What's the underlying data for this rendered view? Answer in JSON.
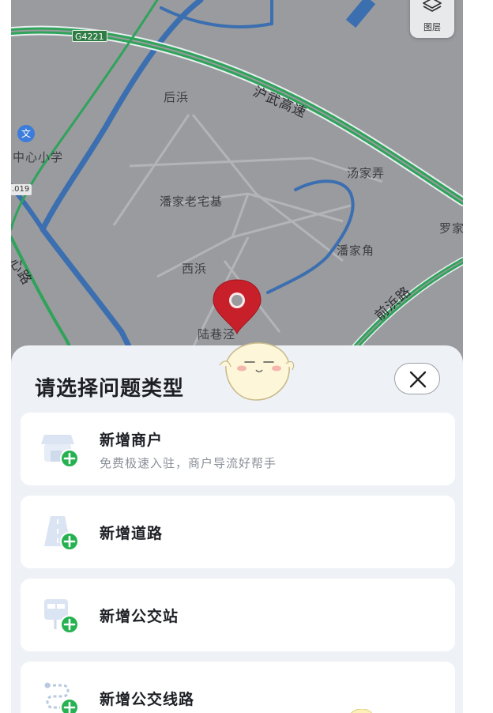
{
  "map": {
    "labels": {
      "houbang": "后浜",
      "huwu": "沪武高速",
      "school": "中心小学",
      "tangjianong": "汤家弄",
      "panjia_old": "潘家老宅基",
      "luojia": "罗家",
      "panjiajiao": "潘家角",
      "xibang": "西浜",
      "qianbang": "前浜路",
      "luxiangjing": "陆巷泾",
      "road_left": "心路"
    },
    "route_shield": "G4221",
    "route_shield2": ".019",
    "poi_badge": "文",
    "layers_label": "图层"
  },
  "sheet": {
    "title": "请选择问题类型",
    "close_icon": "close-icon",
    "options": [
      {
        "title": "新增商户",
        "subtitle": "免费极速入驻，商户导流好帮手",
        "icon": "storefront-add-icon"
      },
      {
        "title": "新增道路",
        "icon": "road-add-icon"
      },
      {
        "title": "新增公交站",
        "icon": "bus-stop-add-icon"
      },
      {
        "title": "新增公交线路",
        "icon": "bus-route-add-icon"
      }
    ]
  },
  "colors": {
    "map_bg": "#9a9b9f",
    "highway_green": "#2fa35a",
    "water_blue": "#3b6fb0",
    "pin_red": "#c8202a",
    "add_green": "#27b252",
    "sheet_bg": "#eef1f5"
  }
}
